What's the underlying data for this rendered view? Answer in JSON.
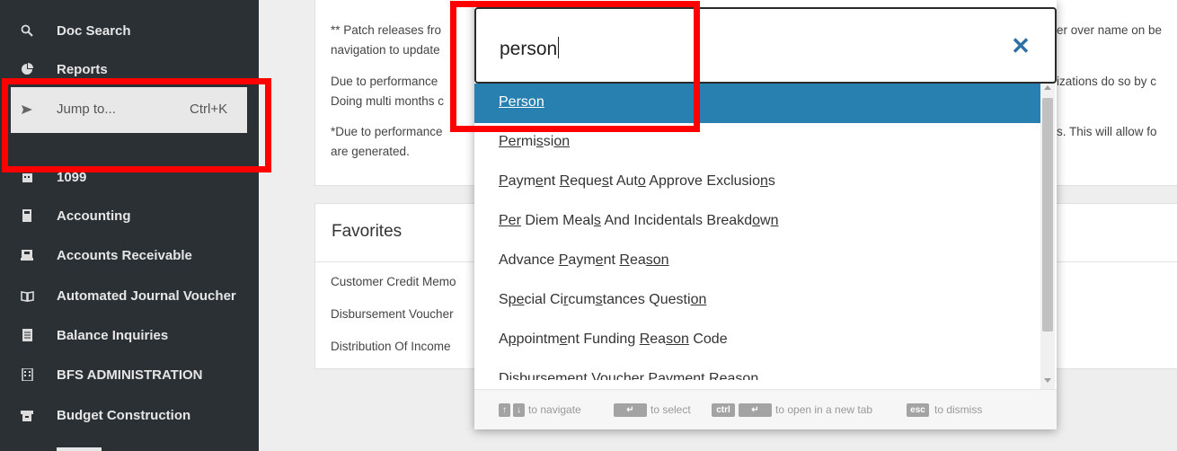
{
  "sidebar": {
    "items": [
      {
        "label": "Doc Search",
        "icon": "search-icon"
      },
      {
        "label": "Reports",
        "icon": "pie-chart-icon"
      },
      {
        "label": "1099",
        "icon": "calendar-icon"
      },
      {
        "label": "Accounting",
        "icon": "calculator-icon"
      },
      {
        "label": "Accounts Receivable",
        "icon": "register-icon"
      },
      {
        "label": "Automated Journal Voucher",
        "icon": "book-icon"
      },
      {
        "label": "Balance Inquiries",
        "icon": "ledger-icon"
      },
      {
        "label": "BFS ADMINISTRATION",
        "icon": "building-icon"
      },
      {
        "label": "Budget Construction",
        "icon": "cabinet-icon"
      }
    ],
    "jump": {
      "label": "Jump to...",
      "shortcut": "Ctrl+K",
      "icon": "send-icon"
    }
  },
  "notes": {
    "line1": "** Patch releases fro",
    "line1b": "navigation to update",
    "line2": "Due to performance",
    "line2b": "Doing multi months c",
    "line3": "*Due to performance",
    "line3b": "are generated.",
    "right1": "er over name on be",
    "right2": "izations do so by c",
    "right3": "s. This will allow fo"
  },
  "favorites": {
    "title": "Favorites",
    "links": [
      "Customer Credit Memo",
      "Disbursement Voucher",
      "Distribution Of Income"
    ]
  },
  "search": {
    "query": "person",
    "close_icon": "✕",
    "results": [
      "Person",
      "Permission",
      "Payment Request Auto Approve Exclusions",
      "Per Diem Meals And Incidentals Breakdown",
      "Advance Payment Reason",
      "Special Circumstances Question",
      "Appointment Funding Reason Code",
      "Disbursement Voucher Payment Reason"
    ],
    "selected_index": 0
  },
  "hints": {
    "up": "↑",
    "down": "↓",
    "navigate": "to navigate",
    "enter": "↵",
    "select": "to select",
    "ctrl": "ctrl",
    "new_tab": "to open in a new tab",
    "esc": "esc",
    "dismiss": "to dismiss"
  },
  "colors": {
    "sidebar_bg": "#2a3034",
    "selected_bg": "#2880b0",
    "close_icon": "#2f6fa8",
    "annotation": "#ff0000"
  }
}
